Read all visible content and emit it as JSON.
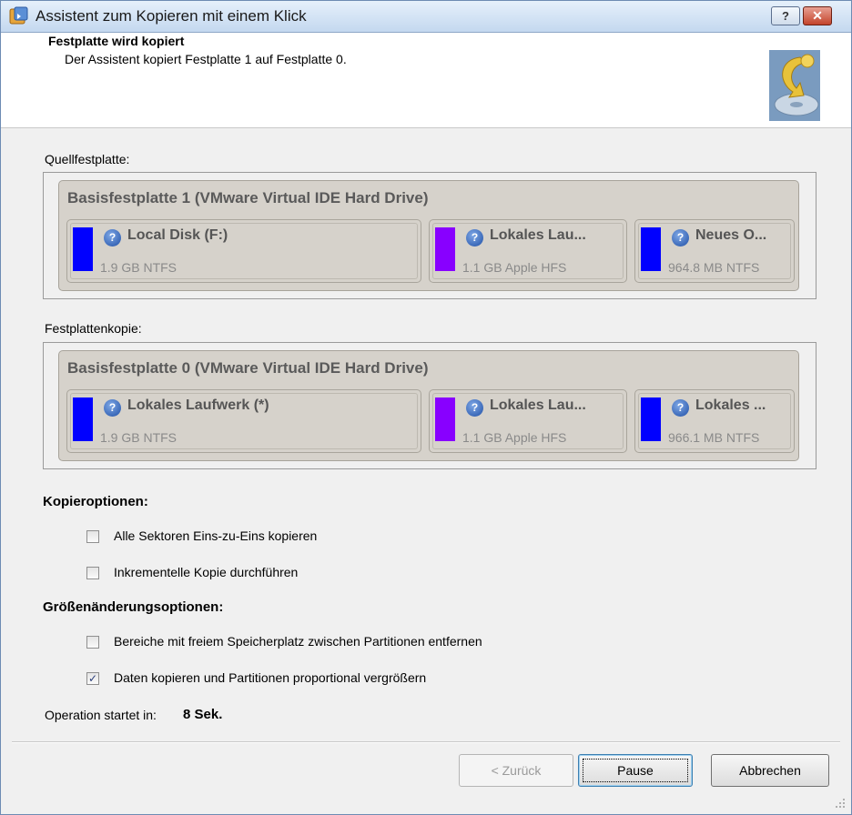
{
  "window": {
    "title": "Assistent zum Kopieren mit einem Klick",
    "help_label": "?",
    "close_label": "✕"
  },
  "header": {
    "title": "Festplatte wird kopiert",
    "subtitle": "Der Assistent kopiert Festplatte 1 auf Festplatte 0."
  },
  "source": {
    "label": "Quellfestplatte:",
    "disk_title": "Basisfestplatte 1 (VMware Virtual IDE Hard Drive)",
    "partitions": [
      {
        "name": "Local Disk (F:)",
        "size": "1.9 GB NTFS",
        "color": "#0000ff"
      },
      {
        "name": "Lokales Lau...",
        "size": "1.1 GB Apple HFS",
        "color": "#8800ff"
      },
      {
        "name": "Neues O...",
        "size": "964.8 MB NTFS",
        "color": "#0000ff"
      }
    ]
  },
  "target": {
    "label": "Festplattenkopie:",
    "disk_title": "Basisfestplatte 0 (VMware Virtual IDE Hard Drive)",
    "partitions": [
      {
        "name": "Lokales Laufwerk (*)",
        "size": "1.9 GB NTFS",
        "color": "#0000ff"
      },
      {
        "name": "Lokales Lau...",
        "size": "1.1 GB Apple HFS",
        "color": "#8800ff"
      },
      {
        "name": "Lokales ...",
        "size": "966.1 MB NTFS",
        "color": "#0000ff"
      }
    ]
  },
  "copy_options": {
    "title": "Kopieroptionen:",
    "items": [
      {
        "label": "Alle Sektoren Eins-zu-Eins kopieren",
        "checked": false
      },
      {
        "label": "Inkrementelle Kopie durchführen",
        "checked": false
      }
    ]
  },
  "resize_options": {
    "title": "Größenänderungsoptionen:",
    "items": [
      {
        "label": "Bereiche mit freiem Speicherplatz zwischen Partitionen entfernen",
        "checked": false
      },
      {
        "label": "Daten kopieren und Partitionen proportional vergrößern",
        "checked": true
      }
    ]
  },
  "status": {
    "prefix": "Operation startet in:",
    "value": "8 Sek."
  },
  "buttons": {
    "back": "< Zurück",
    "pause": "Pause",
    "cancel": "Abbrechen"
  },
  "icons": {
    "help": "help-icon",
    "checkmark": "✓"
  }
}
